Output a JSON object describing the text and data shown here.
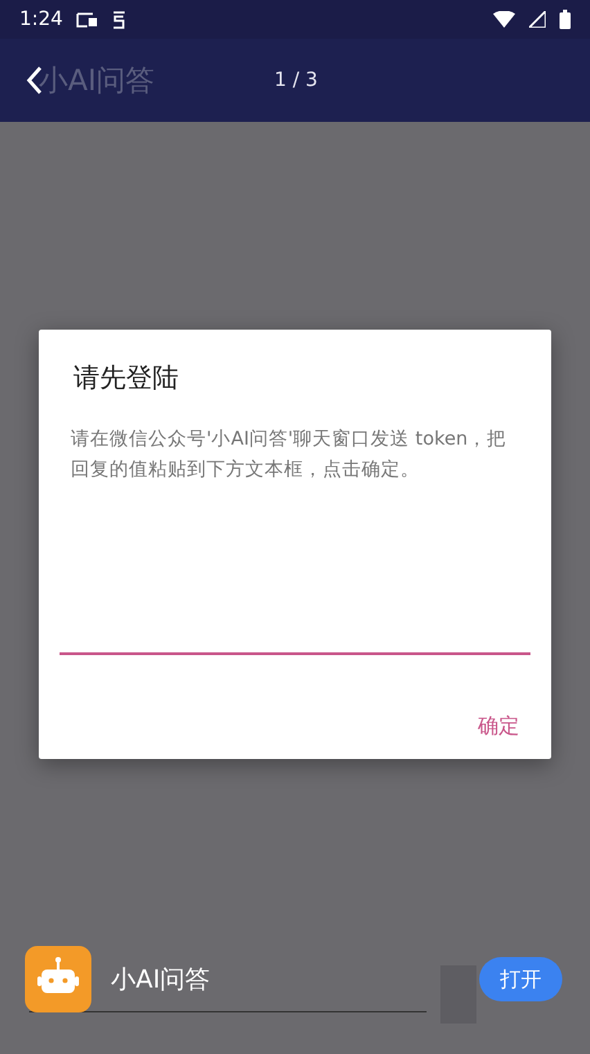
{
  "status_bar": {
    "time": "1:24"
  },
  "app_bar": {
    "title": "小AI问答",
    "page": "1 / 3"
  },
  "dialog": {
    "title": "请先登陆",
    "message": "请在微信公众号'小AI问答'聊天窗口发送 token，把回复的值粘贴到下方文本框，点击确定。",
    "input": {
      "focused": true
    },
    "confirm": "确定"
  },
  "banner": {
    "app_name": "小AI问答",
    "open": "打开"
  }
}
